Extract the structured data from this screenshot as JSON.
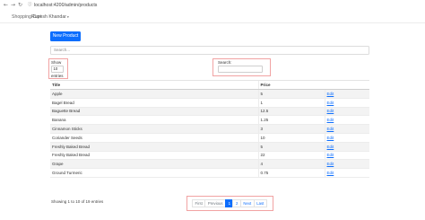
{
  "browser": {
    "url": "localhost:4200/admin/products",
    "back_icon": "arrow-left-icon",
    "forward_icon": "arrow-right-icon",
    "reload_icon": "reload-icon",
    "info_icon": "info-icon"
  },
  "navbar": {
    "brand": "Shopping Cart",
    "user": "Rupesh Khandar",
    "user_caret": "▾"
  },
  "toolbar": {
    "new_product_label": "New Product"
  },
  "main_search": {
    "placeholder": "Search..."
  },
  "length_control": {
    "show_label": "Show",
    "value": "10",
    "entries_label": "entries"
  },
  "table_search": {
    "label": "Search:",
    "value": ""
  },
  "table": {
    "columns": [
      "Title",
      "Price",
      ""
    ],
    "rows": [
      {
        "title": "Apple",
        "price": "5",
        "action": "Edit"
      },
      {
        "title": "Bagel Bread",
        "price": "1",
        "action": "Edit"
      },
      {
        "title": "Baguette Bread",
        "price": "12.5",
        "action": "Edit"
      },
      {
        "title": "Banana",
        "price": "1.25",
        "action": "Edit"
      },
      {
        "title": "Cinnamon Sticks",
        "price": "3",
        "action": "Edit"
      },
      {
        "title": "Coriander Seeds",
        "price": "10",
        "action": "Edit"
      },
      {
        "title": "Freshly Baked Bread",
        "price": "5",
        "action": "Edit"
      },
      {
        "title": "Freshly Baked Bread",
        "price": "22",
        "action": "Edit"
      },
      {
        "title": "Grape",
        "price": "4",
        "action": "Edit"
      },
      {
        "title": "Ground Turmeric",
        "price": "0.75",
        "action": "Edit"
      }
    ]
  },
  "footer": {
    "info": "Showing 1 to 10 of 19 entries"
  },
  "pagination": {
    "first": "First",
    "previous": "Previous",
    "page1": "1",
    "page2": "2",
    "next": "Next",
    "last": "Last"
  },
  "colors": {
    "primary": "#0d6efd",
    "highlight": "#f1a3a3"
  }
}
